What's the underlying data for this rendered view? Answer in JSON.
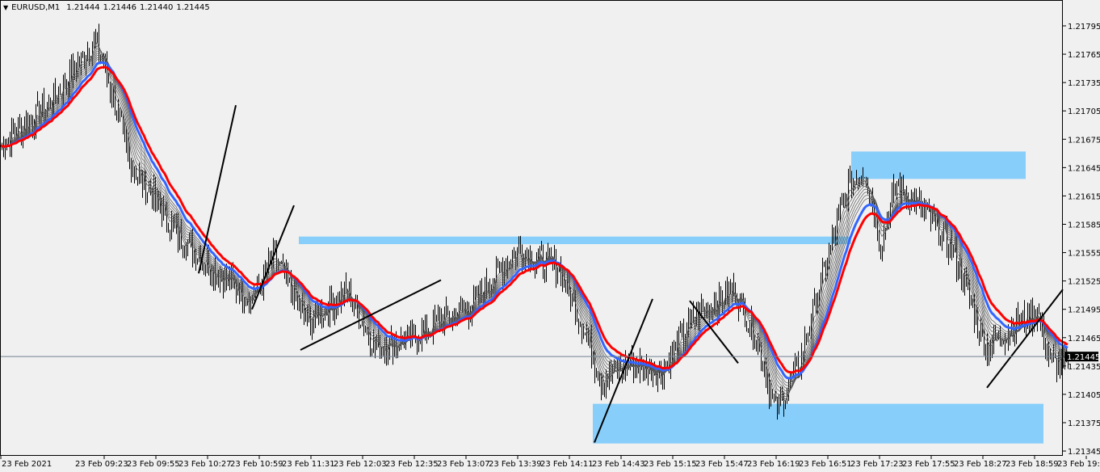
{
  "header": {
    "symbol": "EURUSD,M1",
    "open": "1.21444",
    "high": "1.21446",
    "low": "1.21440",
    "close": "1.21445",
    "menu_icon": "triangle-down-icon"
  },
  "chart_data": {
    "type": "ohlc-bar",
    "symbol": "EURUSD",
    "timeframe": "M1",
    "start_time": "08:37",
    "ylim": [
      1.2133,
      1.2182
    ],
    "y_ticks": [
      "1.21795",
      "1.21765",
      "1.21735",
      "1.21705",
      "1.21675",
      "1.21645",
      "1.21615",
      "1.21585",
      "1.21555",
      "1.21525",
      "1.21495",
      "1.21465",
      "1.21435",
      "1.21405",
      "1.21375",
      "1.21345"
    ],
    "x_ticks": [
      "23 Feb 2021",
      "23 Feb 09:23",
      "23 Feb 09:55",
      "23 Feb 10:27",
      "23 Feb 10:59",
      "23 Feb 11:31",
      "23 Feb 12:03",
      "23 Feb 12:35",
      "23 Feb 13:07",
      "23 Feb 13:39",
      "23 Feb 14:11",
      "23 Feb 14:43",
      "23 Feb 15:15",
      "23 Feb 15:47",
      "23 Feb 16:19",
      "23 Feb 16:51",
      "23 Feb 17:23",
      "23 Feb 17:55",
      "23 Feb 18:27",
      "23 Feb 18:59",
      "23 Feb 19:31"
    ],
    "current_price": "1.21445",
    "price_path": [
      [
        "08:37",
        1.21668
      ],
      [
        "09:07",
        1.21711
      ],
      [
        "09:36",
        1.2178
      ],
      [
        "09:47",
        1.2172
      ],
      [
        "09:57",
        1.21651
      ],
      [
        "10:27",
        1.21574
      ],
      [
        "10:52",
        1.21532
      ],
      [
        "11:12",
        1.21506
      ],
      [
        "11:27",
        1.21549
      ],
      [
        "11:47",
        1.2148
      ],
      [
        "12:12",
        1.21515
      ],
      [
        "12:29",
        1.21455
      ],
      [
        "12:52",
        1.21463
      ],
      [
        "13:07",
        1.2148
      ],
      [
        "13:27",
        1.21497
      ],
      [
        "13:57",
        1.21557
      ],
      [
        "14:22",
        1.2154
      ],
      [
        "14:37",
        1.2148
      ],
      [
        "14:49",
        1.2142
      ],
      [
        "15:07",
        1.21438
      ],
      [
        "15:27",
        1.21429
      ],
      [
        "15:47",
        1.21489
      ],
      [
        "16:12",
        1.21515
      ],
      [
        "16:27",
        1.21455
      ],
      [
        "16:37",
        1.21386
      ],
      [
        "16:52",
        1.21438
      ],
      [
        "17:02",
        1.21506
      ],
      [
        "17:22",
        1.21626
      ],
      [
        "17:32",
        1.21643
      ],
      [
        "17:42",
        1.21566
      ],
      [
        "17:52",
        1.21626
      ],
      [
        "18:12",
        1.21592
      ],
      [
        "18:27",
        1.21557
      ],
      [
        "18:47",
        1.21455
      ],
      [
        "19:07",
        1.2148
      ],
      [
        "19:19",
        1.21493
      ],
      [
        "19:27",
        1.21438
      ]
    ],
    "zones": [
      {
        "from": "17:24",
        "to": "19:12",
        "top": 1.21662,
        "bottom": 1.21633,
        "color": "#87cefa"
      },
      {
        "from": "11:42",
        "to": "17:24",
        "top": 1.21572,
        "bottom": 1.21564,
        "color": "#87cefa"
      },
      {
        "from": "14:44",
        "to": "19:23",
        "top": 1.21395,
        "bottom": 1.21353,
        "color": "#87cefa"
      }
    ],
    "trendlines": [
      [
        [
          "10:40",
          1.21533
        ],
        [
          "11:03",
          1.21711
        ]
      ],
      [
        [
          "11:13",
          1.21495
        ],
        [
          "11:39",
          1.21605
        ]
      ],
      [
        [
          "11:43",
          1.21452
        ],
        [
          "13:10",
          1.21526
        ]
      ],
      [
        [
          "14:45",
          1.21354
        ],
        [
          "15:21",
          1.21506
        ]
      ],
      [
        [
          "15:44",
          1.21504
        ],
        [
          "16:14",
          1.21438
        ]
      ],
      [
        [
          "18:48",
          1.21412
        ],
        [
          "19:35",
          1.21516
        ]
      ]
    ],
    "colors": {
      "bars": "#000000",
      "ma_slow": "#ff0000",
      "ma_fast": "#3366ff",
      "ma_ribbon": "#555555",
      "price_line": "#708090",
      "background": "#f0f0f0"
    }
  }
}
